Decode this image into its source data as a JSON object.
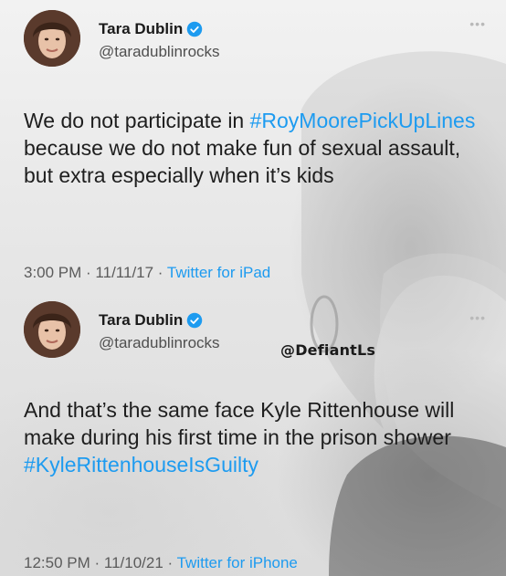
{
  "tweets": [
    {
      "display_name": "Tara Dublin",
      "handle": "@taradublinrocks",
      "text_segments": [
        {
          "text": "We do not participate in ",
          "type": "plain"
        },
        {
          "text": "#RoyMoorePickUpLines",
          "type": "hashtag"
        },
        {
          "text": " because we do not make fun of sexual assault, but extra especially when it’s kids",
          "type": "plain"
        }
      ],
      "time": "3:00 PM",
      "date": "11/11/17",
      "source": "Twitter for iPad"
    },
    {
      "display_name": "Tara Dublin",
      "handle": "@taradublinrocks",
      "text_segments": [
        {
          "text": "And that’s the same face Kyle Rittenhouse will make during his first time in the prison shower ",
          "type": "plain"
        },
        {
          "text": "#KyleRittenhouseIsGuilty",
          "type": "hashtag"
        }
      ],
      "time": "12:50 PM",
      "date": "11/10/21",
      "source": "Twitter for iPhone"
    }
  ],
  "separator": " · ",
  "more_glyph": "•••",
  "watermark": "@DefiantLs",
  "colors": {
    "link": "#1d9bf0",
    "verified": "#1d9bf0",
    "text": "#1e1e1e",
    "secondary": "#5b5b5b"
  },
  "icons": {
    "verified": "verified-badge-icon",
    "more": "more-options-icon"
  }
}
